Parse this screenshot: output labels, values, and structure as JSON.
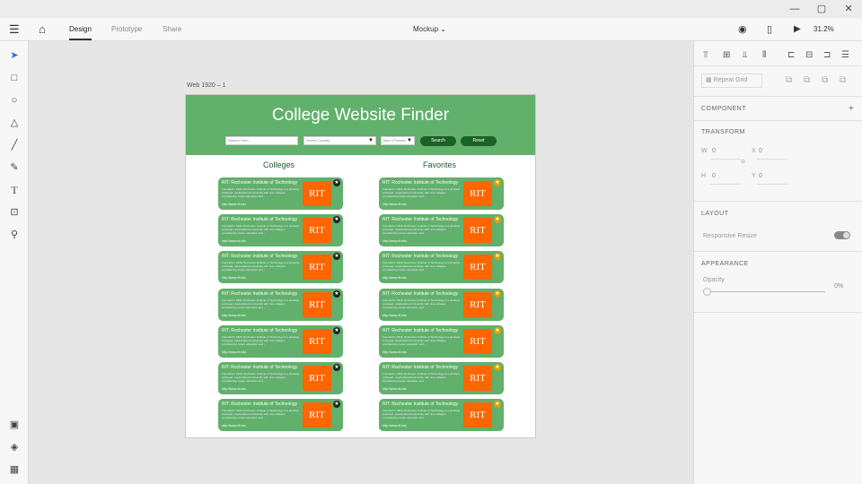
{
  "window": {
    "minimize": "—",
    "maximize": "▢",
    "close": "✕"
  },
  "topbar": {
    "tabs": [
      {
        "label": "Design"
      },
      {
        "label": "Prototype"
      },
      {
        "label": "Share"
      }
    ],
    "doc_title": "Mockup ⌄",
    "zoom": "31.2%"
  },
  "canvas": {
    "artboard_label": "Web 1920 – 1"
  },
  "site": {
    "title": "College Website Finder",
    "search_placeholder": "Search Term",
    "select_country": "Select Country",
    "max_results": "Max # Results",
    "search_btn": "Search",
    "reset_btn": "Reset",
    "col_colleges": "Colleges",
    "col_favorites": "Favorites",
    "card": {
      "title": "RIT: Rochester Institute of Technology",
      "desc": "Founded in 1829, Rochester Institute of Technology is a privately endowed, coeducational university with nine colleges emphasizing career education and ...",
      "url": "http://www.rit.edu",
      "logo": "RIT"
    }
  },
  "panel": {
    "repeat_grid": "Repeat Grid",
    "component": "COMPONENT",
    "component_add": "+",
    "transform": "TRANSFORM",
    "w_label": "W",
    "w_value": "0",
    "x_label": "X",
    "x_value": "0",
    "h_label": "H",
    "h_value": "0",
    "y_label": "Y",
    "y_value": "0",
    "layout": "LAYOUT",
    "responsive_resize": "Responsive Resize",
    "appearance": "APPEARANCE",
    "opacity": "Opacity",
    "opacity_value": "0%"
  },
  "colors": {
    "hero": "#61b06b",
    "button": "#1c6125",
    "logo": "#ff6600",
    "fav_star": "#d9a400"
  }
}
